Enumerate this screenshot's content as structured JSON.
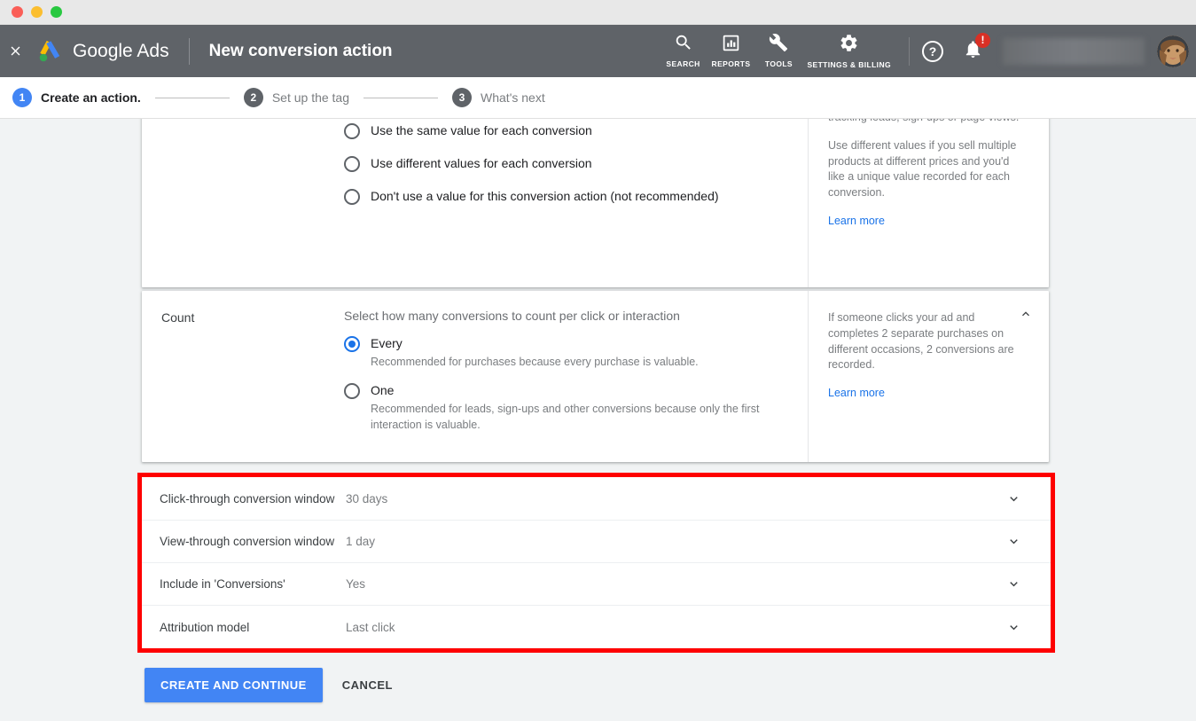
{
  "window": {
    "traffic_lights": [
      "close",
      "minimize",
      "zoom"
    ]
  },
  "topbar": {
    "close_label": "×",
    "brand": "Google Ads",
    "page_title": "New conversion action",
    "items": [
      {
        "icon": "search-icon",
        "label": "SEARCH"
      },
      {
        "icon": "reports-bar-chart-icon",
        "label": "REPORTS"
      },
      {
        "icon": "tools-wrench-icon",
        "label": "TOOLS"
      },
      {
        "icon": "settings-gear-icon",
        "label": "SETTINGS &\nBILLING"
      }
    ],
    "help_label": "?",
    "notification_badge": "!",
    "account_name": ""
  },
  "stepper": {
    "steps": [
      {
        "num": "1",
        "label": "Create an action.",
        "state": "active"
      },
      {
        "num": "2",
        "label": "Set up the tag",
        "state": "inactive"
      },
      {
        "num": "3",
        "label": "What's next",
        "state": "inactive"
      }
    ]
  },
  "value_card": {
    "options": [
      "Use the same value for each conversion",
      "Use different values for each conversion",
      "Don't use a value for this conversion action (not recommended)"
    ],
    "help": {
      "p1": "tracking leads, sign-ups or page views.",
      "p2": "Use different values if you sell multiple products at different prices and you'd like a unique value recorded for each conversion.",
      "learn_more": "Learn more"
    }
  },
  "count_card": {
    "label": "Count",
    "intro": "Select how many conversions to count per click or interaction",
    "options": [
      {
        "title": "Every",
        "subtitle": "Recommended for purchases because every purchase is valuable.",
        "selected": true
      },
      {
        "title": "One",
        "subtitle": "Recommended for leads, sign-ups and other conversions because only the first interaction is valuable.",
        "selected": false
      }
    ],
    "help": {
      "p1": "If someone clicks your ad and completes 2 separate purchases on different occasions, 2 conversions are recorded.",
      "learn_more": "Learn more"
    },
    "collapse_icon": "chevron-up-icon"
  },
  "settings_rows": {
    "highlight_color": "#fe0000",
    "rows": [
      {
        "label": "Click-through conversion window",
        "value": "30 days",
        "icon": "chevron-down-icon"
      },
      {
        "label": "View-through conversion window",
        "value": "1 day",
        "icon": "chevron-down-icon"
      },
      {
        "label": "Include in 'Conversions'",
        "value": "Yes",
        "icon": "chevron-down-icon"
      },
      {
        "label": "Attribution model",
        "value": "Last click",
        "icon": "chevron-down-icon"
      }
    ]
  },
  "footer": {
    "primary_label": "CREATE AND CONTINUE",
    "cancel_label": "CANCEL",
    "primary_color": "#4285f4"
  }
}
